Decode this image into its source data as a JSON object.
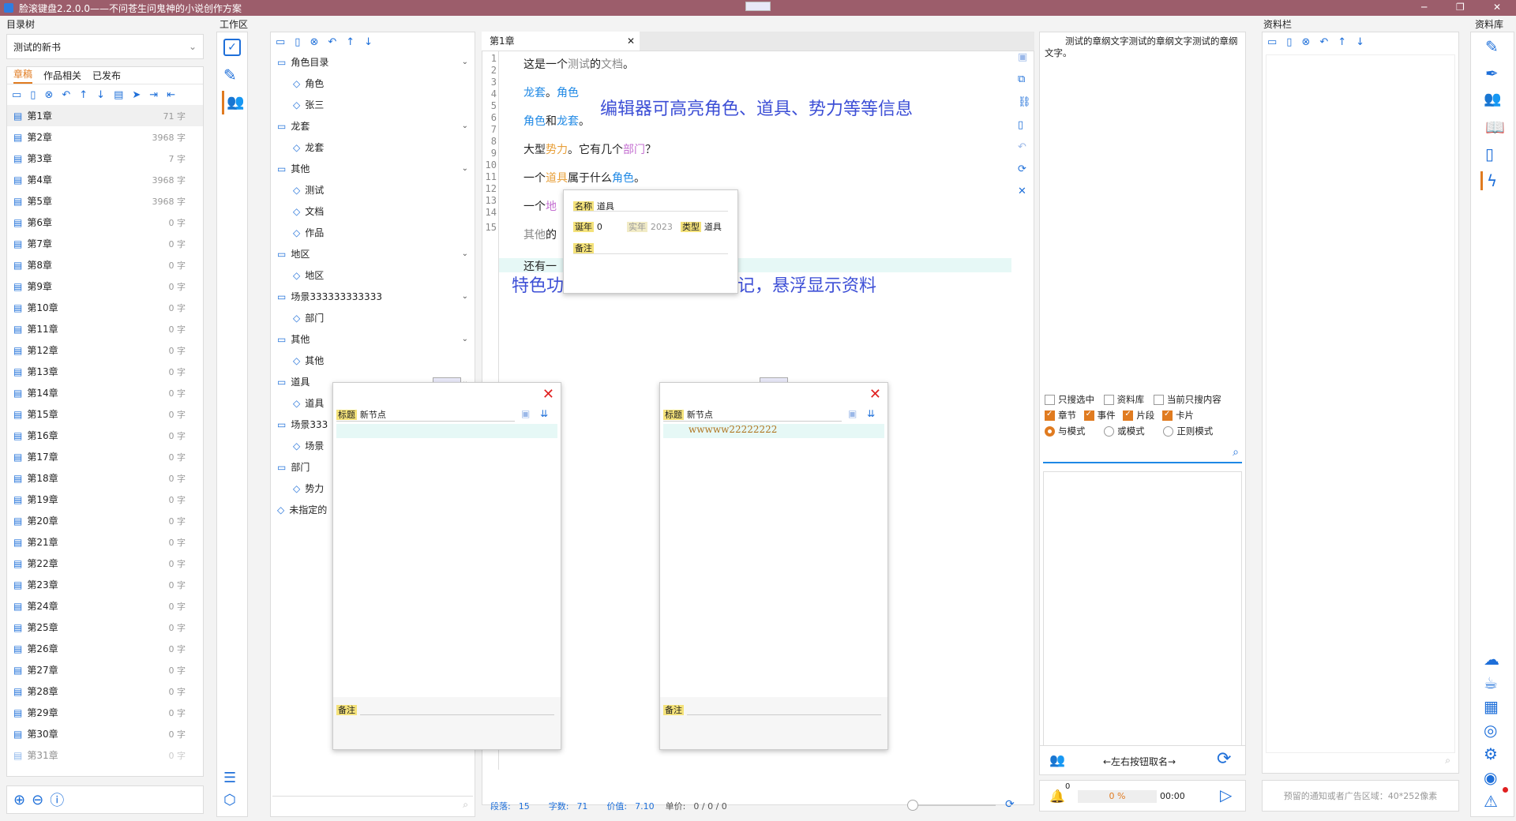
{
  "window": {
    "title": "脸滚键盘2.2.0.0——不问苍生问鬼神的小说创作方案"
  },
  "sections": {
    "tree": "目录树",
    "workspace": "工作区",
    "sidebar": "资料栏",
    "library": "资料库"
  },
  "book": {
    "name": "测试的新书"
  },
  "tabs": [
    "章稿",
    "作品相关",
    "已发布"
  ],
  "chapters": [
    {
      "name": "第1章",
      "count": "71 字"
    },
    {
      "name": "第2章",
      "count": "3968 字"
    },
    {
      "name": "第3章",
      "count": "7 字"
    },
    {
      "name": "第4章",
      "count": "3968 字"
    },
    {
      "name": "第5章",
      "count": "3968 字"
    },
    {
      "name": "第6章",
      "count": "0 字"
    },
    {
      "name": "第7章",
      "count": "0 字"
    },
    {
      "name": "第8章",
      "count": "0 字"
    },
    {
      "name": "第9章",
      "count": "0 字"
    },
    {
      "name": "第10章",
      "count": "0 字"
    },
    {
      "name": "第11章",
      "count": "0 字"
    },
    {
      "name": "第12章",
      "count": "0 字"
    },
    {
      "name": "第13章",
      "count": "0 字"
    },
    {
      "name": "第14章",
      "count": "0 字"
    },
    {
      "name": "第15章",
      "count": "0 字"
    },
    {
      "name": "第16章",
      "count": "0 字"
    },
    {
      "name": "第17章",
      "count": "0 字"
    },
    {
      "name": "第18章",
      "count": "0 字"
    },
    {
      "name": "第19章",
      "count": "0 字"
    },
    {
      "name": "第20章",
      "count": "0 字"
    },
    {
      "name": "第21章",
      "count": "0 字"
    },
    {
      "name": "第22章",
      "count": "0 字"
    },
    {
      "name": "第23章",
      "count": "0 字"
    },
    {
      "name": "第24章",
      "count": "0 字"
    },
    {
      "name": "第25章",
      "count": "0 字"
    },
    {
      "name": "第26章",
      "count": "0 字"
    },
    {
      "name": "第27章",
      "count": "0 字"
    },
    {
      "name": "第28章",
      "count": "0 字"
    },
    {
      "name": "第29章",
      "count": "0 字"
    },
    {
      "name": "第30章",
      "count": "0 字"
    },
    {
      "name": "第31章",
      "count": "0 字"
    }
  ],
  "tree": [
    {
      "label": "角色目录",
      "type": "folder"
    },
    {
      "label": "角色",
      "type": "tag"
    },
    {
      "label": "张三",
      "type": "tag"
    },
    {
      "label": "龙套",
      "type": "folder"
    },
    {
      "label": "龙套",
      "type": "tag"
    },
    {
      "label": "其他",
      "type": "folder"
    },
    {
      "label": "测试",
      "type": "tag"
    },
    {
      "label": "文档",
      "type": "tag"
    },
    {
      "label": "作品",
      "type": "tag"
    },
    {
      "label": "地区",
      "type": "folder"
    },
    {
      "label": "地区",
      "type": "tag"
    },
    {
      "label": "场景333333333333",
      "type": "folder"
    },
    {
      "label": "部门",
      "type": "tag"
    },
    {
      "label": "其他",
      "type": "folder"
    },
    {
      "label": "其他",
      "type": "tag"
    },
    {
      "label": "道具",
      "type": "folder"
    },
    {
      "label": "道具",
      "type": "tag"
    },
    {
      "label": "场景333",
      "type": "folder"
    },
    {
      "label": "场景",
      "type": "tag"
    },
    {
      "label": "部门",
      "type": "folder"
    },
    {
      "label": "势力",
      "type": "tag"
    },
    {
      "label": "未指定的",
      "type": "tag"
    }
  ],
  "editor": {
    "tab": "第1章",
    "line_numbers": [
      "1",
      "2",
      "3",
      "4",
      "5",
      "6",
      "7",
      "8",
      "9",
      "10",
      "11",
      "12",
      "13",
      "14",
      "15"
    ],
    "l1": [
      "这是一个",
      "测试",
      "的",
      "文档",
      "。"
    ],
    "l3": [
      "龙套",
      "。",
      "角色"
    ],
    "l5": [
      "角色",
      "和",
      "龙套",
      "。"
    ],
    "l7": [
      "大型",
      "势力",
      "。它有几个",
      "部门",
      "？"
    ],
    "l9": [
      "一个",
      "道具",
      "属于什么",
      "角色",
      "。"
    ],
    "l11": [
      "一个",
      "地"
    ],
    "l13": [
      "其他",
      "的"
    ],
    "l15": [
      "还有一"
    ],
    "status": {
      "para_label": "段落:",
      "para": "15",
      "words_label": "字数:",
      "words": "71",
      "value_label": "价值:",
      "value": "7.10",
      "price_label": "单价:",
      "price": "0 / 0 / 0"
    }
  },
  "annotations": {
    "a1": "编辑器可高亮角色、道具、势力等等信息",
    "a2": "特色功能，鼠标移动到高亮标记，悬浮显示资料"
  },
  "tooltip": {
    "name_label": "名称",
    "name": "道具",
    "born_label": "诞年",
    "born": "0",
    "real_label": "实年",
    "real": "2023",
    "type_label": "类型",
    "type": "道具",
    "note_label": "备注"
  },
  "float_left": {
    "title_label": "标题",
    "title": "新节点",
    "note_label": "备注"
  },
  "float_right": {
    "title_label": "标题",
    "title": "新节点",
    "content": "wwwww22222222",
    "note_label": "备注"
  },
  "outline": {
    "text": "测试的章纲文字测试的章纲文字测试的章纲文字。"
  },
  "search": {
    "only_selected": "只搜选中",
    "library": "资料库",
    "only_current": "当前只搜内容",
    "chapter": "章节",
    "event": "事件",
    "fragment": "片段",
    "card": "卡片",
    "and_mode": "与模式",
    "or_mode": "或模式",
    "regex_mode": "正则模式"
  },
  "naming": {
    "label": "←左右按钮取名→"
  },
  "progress": {
    "percent": "0 %",
    "time": "00:00",
    "notify": "0"
  },
  "ad": {
    "text": "预留的通知或者广告区域：40*252像素"
  },
  "colors": {
    "titlebar": "#9c5d6b",
    "accent": "#e07b20",
    "highlight_blue": "#1e88e5",
    "annotation": "#3d4fd6"
  }
}
